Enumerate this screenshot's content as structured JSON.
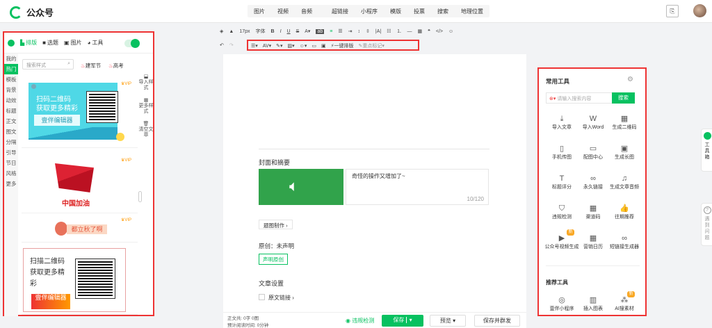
{
  "app": {
    "title": "公众号"
  },
  "insert_toolbar": {
    "items": [
      "图片",
      "视频",
      "音频",
      "超链接",
      "小程序",
      "模版",
      "投票",
      "搜索",
      "地理位置"
    ]
  },
  "format_toolbar": {
    "font_size": "17px",
    "font_label": "字体",
    "one_click_format": "一键排版",
    "highlight": "重点标记"
  },
  "left_panel": {
    "tabs": [
      "排版",
      "选题",
      "图片",
      "工具"
    ],
    "categories": [
      "我的",
      "热门",
      "模板",
      "背景",
      "动效",
      "标题",
      "正文",
      "图文",
      "分隔",
      "引导",
      "节日",
      "风格",
      "更多"
    ],
    "search_placeholder": "搜索样式",
    "hot_tags": [
      "建军节",
      "高考"
    ],
    "template1_line1": "扫码二维码",
    "template1_line2": "获取更多精彩",
    "template1_button": "壹伴编辑器",
    "template2_text": "中国加油",
    "template3_text": "都立秋了啊",
    "template4_line1": "扫描二维码",
    "template4_line2": "获取更多精",
    "template4_line3": "彩",
    "template4_button": "壹伴编辑器",
    "vip": "VIP",
    "side_tools": [
      "导入样式",
      "更多样式",
      "清空文章"
    ]
  },
  "editor": {
    "cover_section_title": "封面和摘要",
    "summary_text": "奇怪的操作又增加了~",
    "summary_counter": "10/120",
    "cover_make_button": "题图制作",
    "original_label": "原创：未声明",
    "declare_original_button": "声明原创",
    "article_settings": "文章设置",
    "original_link": "原文链接"
  },
  "right_panel": {
    "title": "常用工具",
    "search_placeholder": "请输入搜索内容",
    "search_button": "搜索",
    "tools": [
      {
        "label": "导入文章",
        "icon": "⤓"
      },
      {
        "label": "导入Word",
        "icon": "W"
      },
      {
        "label": "生成二维码",
        "icon": "▦"
      },
      {
        "label": "手机传图",
        "icon": "▯"
      },
      {
        "label": "配图中心",
        "icon": "▭"
      },
      {
        "label": "生成长图",
        "icon": "▣"
      },
      {
        "label": "标题评分",
        "icon": "T"
      },
      {
        "label": "永久链接",
        "icon": "∞"
      },
      {
        "label": "生成文章音频",
        "icon": "♫"
      },
      {
        "label": "违规检测",
        "icon": "⛉"
      },
      {
        "label": "渠道码",
        "icon": "▦"
      },
      {
        "label": "往期推荐",
        "icon": "👍"
      },
      {
        "label": "公众号视频生成",
        "icon": "▶"
      },
      {
        "label": "营销日历",
        "icon": "▦"
      },
      {
        "label": "短链接生成器",
        "icon": "∞"
      }
    ],
    "new_badge": "新",
    "recommend_title": "推荐工具",
    "recommend": [
      {
        "label": "壹伴小程序",
        "icon": "◎"
      },
      {
        "label": "插入图表",
        "icon": "▥"
      },
      {
        "label": "AI搜素材",
        "icon": "⁂"
      }
    ]
  },
  "float_side": {
    "toolbox": "工具箱",
    "help": "遇到问题"
  },
  "bottom_bar": {
    "word_count": "正文共: 0字 0图",
    "reading_time": "预计阅读时间: 0分钟",
    "check": "违规检测",
    "save": "保存",
    "preview": "预览",
    "save_send": "保存并群发"
  },
  "colors": {
    "accent": "#07c160",
    "highlight_border": "#ee3333"
  }
}
